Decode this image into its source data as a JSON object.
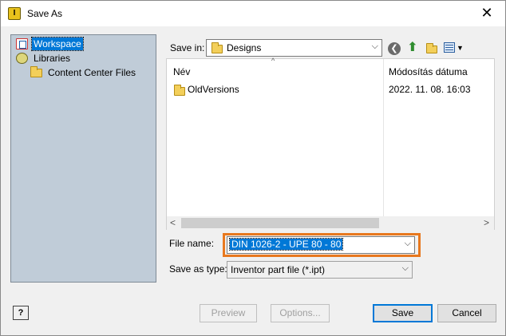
{
  "window": {
    "title": "Save As",
    "app_icon_glyph": "I"
  },
  "places": [
    {
      "label": "Workspace",
      "icon": "workspace-icon",
      "selected": true
    },
    {
      "label": "Libraries",
      "icon": "libraries-icon",
      "selected": false
    },
    {
      "label": "Content Center Files",
      "icon": "folder-icon",
      "selected": false
    }
  ],
  "save_in": {
    "label": "Save in:",
    "value": "Designs"
  },
  "file_list": {
    "columns": {
      "name": "Név",
      "date": "Módosítás dátuma"
    },
    "rows": [
      {
        "name": "OldVersions",
        "date": "2022. 11. 08. 16:03",
        "icon": "folder-icon"
      }
    ]
  },
  "file_name": {
    "label": "File name:",
    "value": "DIN 1026-2 - UPE 80 - 80"
  },
  "save_as_type": {
    "label": "Save as type:",
    "value": "Inventor part file (*.ipt)"
  },
  "buttons": {
    "help": "?",
    "preview": "Preview",
    "options": "Options...",
    "save": "Save",
    "cancel": "Cancel"
  },
  "colors": {
    "highlight_border": "#e8781e",
    "selection": "#0078d7",
    "places_bg": "#c0ccd8"
  }
}
